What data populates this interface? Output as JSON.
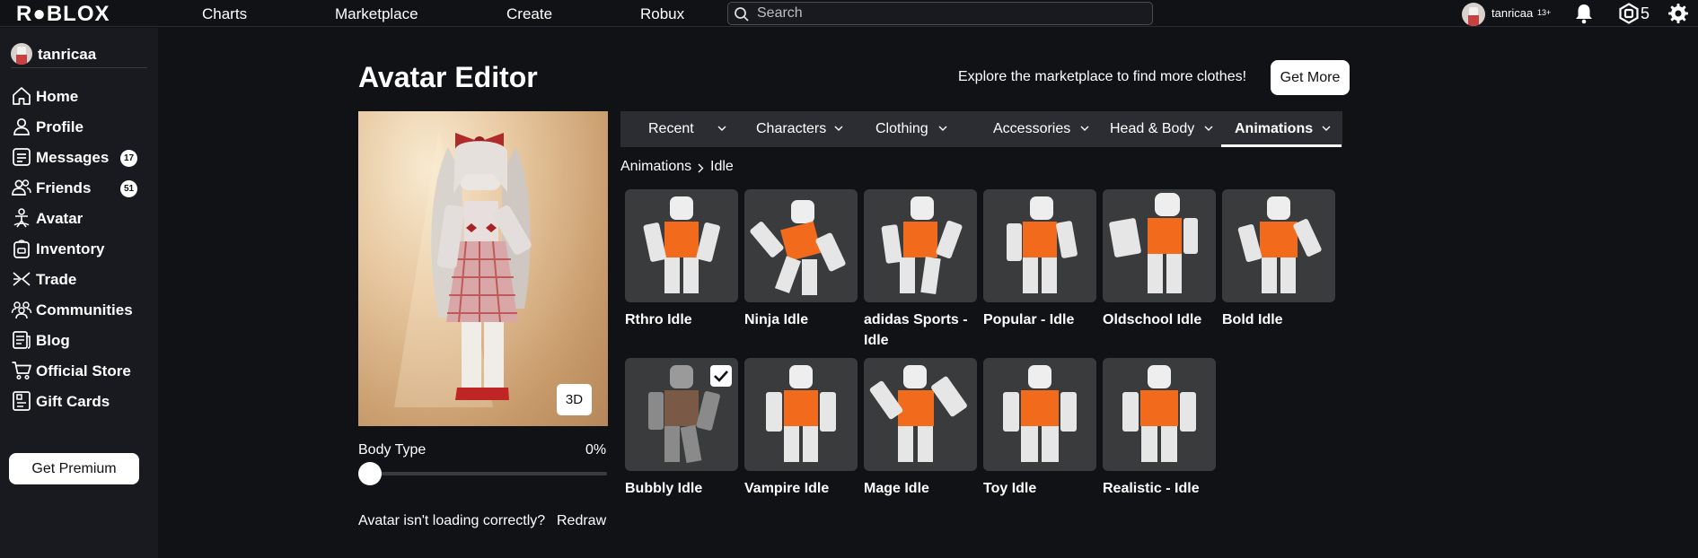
{
  "header": {
    "logo": "R●BLOX",
    "nav": [
      "Charts",
      "Marketplace",
      "Create",
      "Robux"
    ],
    "search_placeholder": "Search",
    "username": "tanricaa",
    "age_badge": "13+",
    "robux_count": "5"
  },
  "sidebar": {
    "username": "tanricaa",
    "items": [
      {
        "label": "Home",
        "icon": "home-icon"
      },
      {
        "label": "Profile",
        "icon": "profile-icon"
      },
      {
        "label": "Messages",
        "icon": "messages-icon",
        "badge": "17"
      },
      {
        "label": "Friends",
        "icon": "friends-icon",
        "badge": "51"
      },
      {
        "label": "Avatar",
        "icon": "avatar-icon"
      },
      {
        "label": "Inventory",
        "icon": "inventory-icon"
      },
      {
        "label": "Trade",
        "icon": "trade-icon"
      },
      {
        "label": "Communities",
        "icon": "communities-icon"
      },
      {
        "label": "Blog",
        "icon": "blog-icon"
      },
      {
        "label": "Official Store",
        "icon": "store-icon"
      },
      {
        "label": "Gift Cards",
        "icon": "gift-card-icon"
      }
    ],
    "premium_label": "Get Premium"
  },
  "main": {
    "title": "Avatar Editor",
    "promo_text": "Explore the marketplace to find more clothes!",
    "get_more_label": "Get More",
    "view_3d_label": "3D",
    "body_type_label": "Body Type",
    "body_type_value": "0%",
    "body_type_fraction": 0,
    "redraw_question": "Avatar isn't loading correctly?",
    "redraw_label": "Redraw",
    "tabs": [
      {
        "label": "Recent",
        "active": false
      },
      {
        "label": "Characters",
        "active": false
      },
      {
        "label": "Clothing",
        "active": false
      },
      {
        "label": "Accessories",
        "active": false
      },
      {
        "label": "Head & Body",
        "active": false
      },
      {
        "label": "Animations",
        "active": true
      }
    ],
    "breadcrumb": [
      "Animations",
      "Idle"
    ],
    "items": [
      {
        "name": "Rthro Idle",
        "equipped": false
      },
      {
        "name": "Ninja Idle",
        "equipped": false
      },
      {
        "name": "adidas Sports - Idle",
        "equipped": false
      },
      {
        "name": "Popular - Idle",
        "equipped": false
      },
      {
        "name": "Oldschool Idle",
        "equipped": false
      },
      {
        "name": "Bold Idle",
        "equipped": false
      },
      {
        "name": "Bubbly Idle",
        "equipped": true
      },
      {
        "name": "Vampire Idle",
        "equipped": false
      },
      {
        "name": "Mage Idle",
        "equipped": false
      },
      {
        "name": "Toy Idle",
        "equipped": false
      },
      {
        "name": "Realistic - Idle",
        "equipped": false
      }
    ]
  },
  "colors": {
    "background": "#111216",
    "sidebar": "#191a1f",
    "tab_bar": "#2b2d33",
    "card": "#393b3d",
    "torso_orange": "#f26b1d"
  }
}
